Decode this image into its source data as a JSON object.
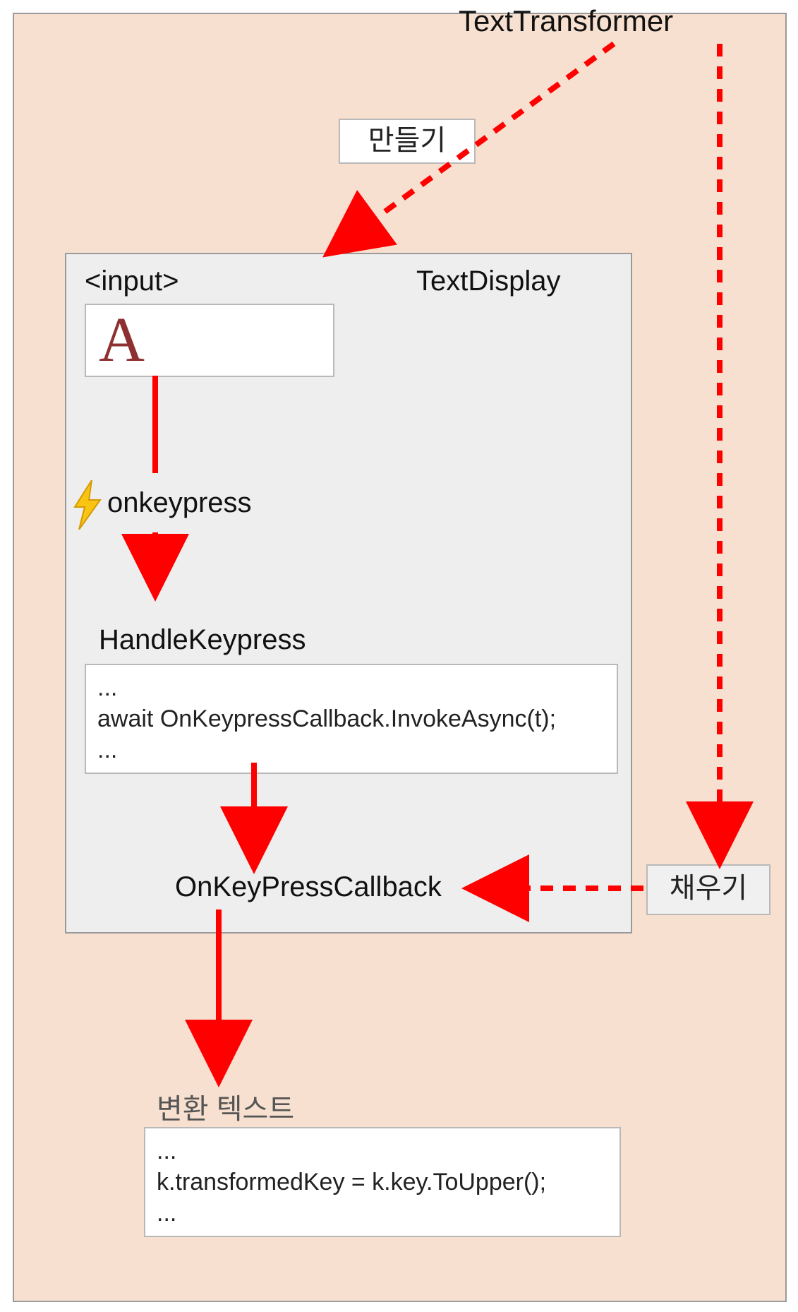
{
  "title": "TextTransformer",
  "create_label": "만들기",
  "fill_label": "채우기",
  "text_display": {
    "input_tag": "<input>",
    "component_name": "TextDisplay",
    "input_value": "A",
    "event_name": "onkeypress",
    "handler_name": "HandleKeypress",
    "handler_code_1": "...",
    "handler_code_2": "await OnKeypressCallback.InvokeAsync(t);",
    "handler_code_3": "...",
    "callback_name": "OnKeyPressCallback"
  },
  "transform": {
    "heading": "변환 텍스트",
    "code_1": "...",
    "code_2": "k.transformedKey = k.key.ToUpper();",
    "code_3": "..."
  }
}
